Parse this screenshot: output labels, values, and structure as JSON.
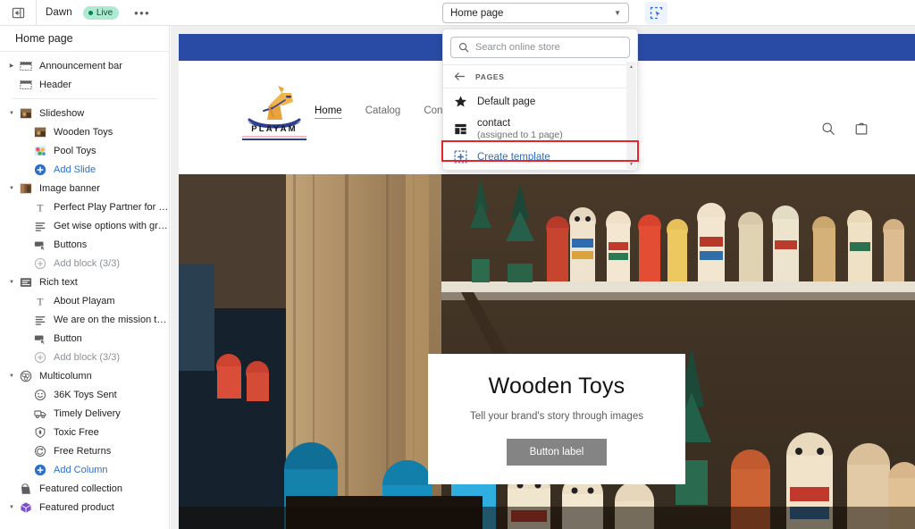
{
  "topbar": {
    "back_icon": "panel-collapse-icon",
    "theme_name": "Dawn",
    "status_label": "Live",
    "more_label": "•••",
    "page_selector_value": "Home page",
    "inspector_icon": "select-element-icon"
  },
  "sidebar": {
    "title": "Home page",
    "items": [
      {
        "label": "Announcement bar",
        "level": 0,
        "icon": "section-bar-icon",
        "twisty": "right",
        "type": "section"
      },
      {
        "label": "Header",
        "level": 0,
        "icon": "section-bar-icon",
        "twisty": "",
        "type": "section"
      },
      {
        "label": "Slideshow",
        "level": 0,
        "icon": "image-thumb-icon",
        "twisty": "down",
        "type": "section"
      },
      {
        "label": "Wooden Toys",
        "level": 1,
        "icon": "image-thumb-icon",
        "twisty": "",
        "type": "block"
      },
      {
        "label": "Pool Toys",
        "level": 1,
        "icon": "image-thumb-pool-icon",
        "twisty": "",
        "type": "block"
      },
      {
        "label": "Add Slide",
        "level": 1,
        "icon": "plus-circle-icon",
        "twisty": "",
        "type": "add"
      },
      {
        "label": "Image banner",
        "level": 0,
        "icon": "image-banner-icon",
        "twisty": "down",
        "type": "section"
      },
      {
        "label": "Perfect Play Partner for your k...",
        "level": 1,
        "icon": "text-heading-icon",
        "twisty": "",
        "type": "block"
      },
      {
        "label": "Get wise options with great di...",
        "level": 1,
        "icon": "text-lines-icon",
        "twisty": "",
        "type": "block"
      },
      {
        "label": "Buttons",
        "level": 1,
        "icon": "button-icon",
        "twisty": "",
        "type": "block"
      },
      {
        "label": "Add block (3/3)",
        "level": 1,
        "icon": "plus-circle-muted-icon",
        "twisty": "",
        "type": "disabled"
      },
      {
        "label": "Rich text",
        "level": 0,
        "icon": "rich-text-icon",
        "twisty": "down",
        "type": "section"
      },
      {
        "label": "About Playam",
        "level": 1,
        "icon": "text-heading-icon",
        "twisty": "",
        "type": "block"
      },
      {
        "label": "We are on the mission to disc...",
        "level": 1,
        "icon": "text-lines-icon",
        "twisty": "",
        "type": "block"
      },
      {
        "label": "Button",
        "level": 1,
        "icon": "button-icon",
        "twisty": "",
        "type": "block"
      },
      {
        "label": "Add block (3/3)",
        "level": 1,
        "icon": "plus-circle-muted-icon",
        "twisty": "",
        "type": "disabled"
      },
      {
        "label": "Multicolumn",
        "level": 0,
        "icon": "multicolumn-icon",
        "twisty": "down",
        "type": "section"
      },
      {
        "label": "36K Toys Sent",
        "level": 1,
        "icon": "smiley-icon",
        "twisty": "",
        "type": "block"
      },
      {
        "label": "Timely Delivery",
        "level": 1,
        "icon": "truck-icon",
        "twisty": "",
        "type": "block"
      },
      {
        "label": "Toxic Free",
        "level": 1,
        "icon": "leaf-shield-icon",
        "twisty": "",
        "type": "block"
      },
      {
        "label": "Free Returns",
        "level": 1,
        "icon": "return-arrow-icon",
        "twisty": "",
        "type": "block"
      },
      {
        "label": "Add Column",
        "level": 1,
        "icon": "plus-circle-icon",
        "twisty": "",
        "type": "add"
      },
      {
        "label": "Featured collection",
        "level": 0,
        "icon": "collection-tag-icon",
        "twisty": "",
        "type": "section"
      },
      {
        "label": "Featured product",
        "level": 0,
        "icon": "product-box-icon",
        "twisty": "down",
        "type": "section"
      }
    ]
  },
  "dropdown": {
    "search_placeholder": "Search online store",
    "search_value": "",
    "search_icon": "search-icon",
    "back_icon": "arrow-left-icon",
    "back_label": "PAGES",
    "items": [
      {
        "label": "Default page",
        "sub": "",
        "icon": "star-icon",
        "accent": false
      },
      {
        "label": "contact",
        "sub": "(assigned to 1 page)",
        "icon": "template-grid-icon",
        "accent": false
      },
      {
        "label": "Create template",
        "sub": "",
        "icon": "add-template-icon",
        "accent": true
      }
    ],
    "highlight_color": "#e8232a"
  },
  "preview": {
    "announcement_bar_color": "#2a4ba5",
    "store": {
      "logo_text": "PLAYAM",
      "logo_icon": "rocking-horse-icon",
      "nav": [
        {
          "label": "Home",
          "active": true
        },
        {
          "label": "Catalog",
          "active": false
        },
        {
          "label": "Contact",
          "active": false
        }
      ],
      "search_icon": "search-icon",
      "cart_icon": "shopping-bag-icon"
    },
    "hero": {
      "heading": "Wooden Toys",
      "subheading": "Tell your brand's story through images",
      "button_label": "Button label",
      "button_color": "#848484"
    }
  }
}
